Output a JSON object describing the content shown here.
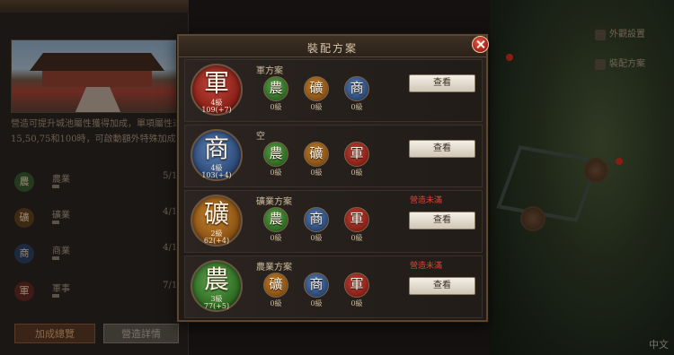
{
  "background": {
    "top_strip_text": "",
    "left_description": "營造可提升城池屬性獲得加成，單項屬性達到15,50,75和100時，可啟動額外特殊加成。",
    "left_rows": [
      {
        "icon_label": "農",
        "name": "農業",
        "value": "5/100",
        "icon_color": "#2e6c22"
      },
      {
        "icon_label": "礦",
        "name": "礦業",
        "value": "4/100",
        "icon_color": "#8a5214"
      },
      {
        "icon_label": "商",
        "name": "商業",
        "value": "4/100",
        "icon_color": "#2c4a78"
      },
      {
        "icon_label": "軍",
        "name": "軍事",
        "value": "7/100",
        "icon_color": "#8a2018"
      }
    ],
    "btn_bonus_overview": "加成總覽",
    "btn_build_detail": "營造詳情",
    "map_btn_appearance": "外觀設置",
    "map_btn_loadout": "裝配方案",
    "map_corner_label": "中文"
  },
  "modal": {
    "title": "裝配方案",
    "rows": [
      {
        "title": "軍方案",
        "warning": "",
        "main": {
          "glyph": "軍",
          "level": "4級",
          "count": "109(+7)",
          "color": "red"
        },
        "slots": [
          {
            "glyph": "農",
            "level": "0級",
            "color": "green"
          },
          {
            "glyph": "礦",
            "level": "0級",
            "color": "orange"
          },
          {
            "glyph": "商",
            "level": "0級",
            "color": "blue"
          }
        ],
        "button": "查看"
      },
      {
        "title": "空",
        "warning": "",
        "main": {
          "glyph": "商",
          "level": "4級",
          "count": "103(+4)",
          "color": "blue"
        },
        "slots": [
          {
            "glyph": "農",
            "level": "0級",
            "color": "green"
          },
          {
            "glyph": "礦",
            "level": "0級",
            "color": "orange"
          },
          {
            "glyph": "軍",
            "level": "0級",
            "color": "red"
          }
        ],
        "button": "查看"
      },
      {
        "title": "礦業方案",
        "warning": "營造未滿",
        "main": {
          "glyph": "礦",
          "level": "2級",
          "count": "62(+4)",
          "color": "orange"
        },
        "slots": [
          {
            "glyph": "農",
            "level": "0級",
            "color": "green"
          },
          {
            "glyph": "商",
            "level": "0級",
            "color": "blue"
          },
          {
            "glyph": "軍",
            "level": "0級",
            "color": "red"
          }
        ],
        "button": "查看"
      },
      {
        "title": "農業方案",
        "warning": "營造未滿",
        "main": {
          "glyph": "農",
          "level": "3級",
          "count": "77(+5)",
          "color": "green"
        },
        "slots": [
          {
            "glyph": "礦",
            "level": "0級",
            "color": "orange"
          },
          {
            "glyph": "商",
            "level": "0級",
            "color": "blue"
          },
          {
            "glyph": "軍",
            "level": "0級",
            "color": "red"
          }
        ],
        "button": "查看"
      }
    ]
  }
}
